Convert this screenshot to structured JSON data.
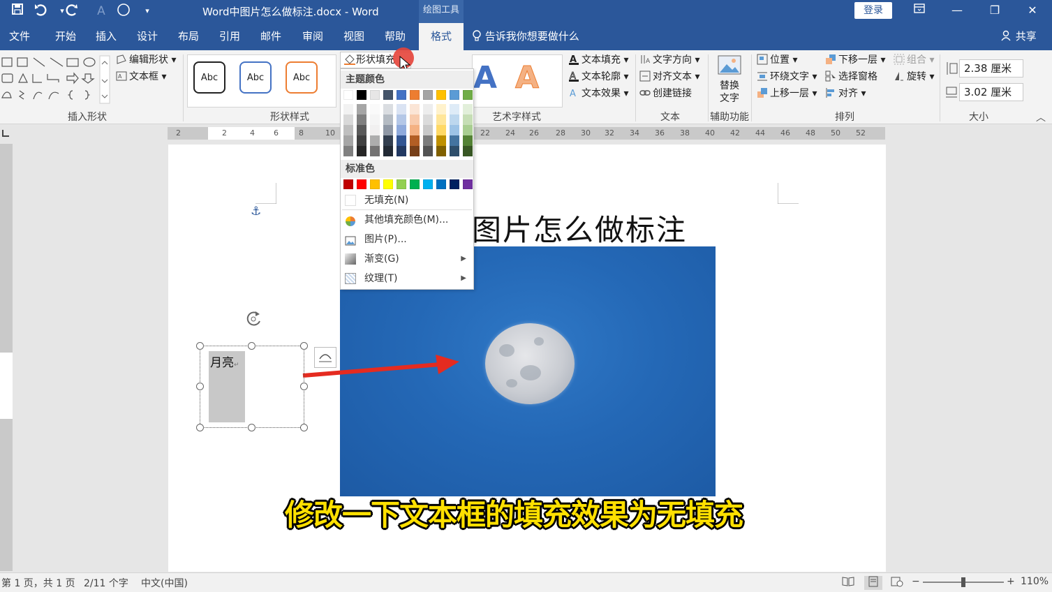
{
  "title_bar": {
    "doc_title": "Word中图片怎么做标注.docx  -  Word",
    "context_tab": "绘图工具",
    "login_label": "登录",
    "icons": [
      "save-icon",
      "undo-icon",
      "redo-icon",
      "text-effect-icon",
      "shape-oval-icon",
      "customize-qat-icon"
    ]
  },
  "tabs": [
    {
      "label": "文件"
    },
    {
      "label": "开始"
    },
    {
      "label": "插入"
    },
    {
      "label": "设计"
    },
    {
      "label": "布局"
    },
    {
      "label": "引用"
    },
    {
      "label": "邮件"
    },
    {
      "label": "审阅"
    },
    {
      "label": "视图"
    },
    {
      "label": "帮助"
    },
    {
      "label": "格式",
      "active": true
    }
  ],
  "tell_me": "告诉我你想要做什么",
  "share_label": "共享",
  "ribbon": {
    "insert_shapes": {
      "edit_shape": "编辑形状",
      "text_box": "文本框",
      "label": "插入形状"
    },
    "shape_styles": {
      "samples": [
        "Abc",
        "Abc",
        "Abc"
      ],
      "shape_fill": "形状填充",
      "label": "形状样式"
    },
    "wordart": {
      "text_fill": "文本填充",
      "text_outline": "文本轮廓",
      "text_effects": "文本效果",
      "label": "艺术字样式"
    },
    "text": {
      "text_direction": "文字方向",
      "align_text": "对齐文本",
      "create_link": "创建链接",
      "label": "文本"
    },
    "accessibility": {
      "alt_text_line1": "替换",
      "alt_text_line2": "文字",
      "label": "辅助功能"
    },
    "arrange": {
      "position": "位置",
      "wrap_text": "环绕文字",
      "bring_forward": "上移一层",
      "send_backward": "下移一层",
      "selection_pane": "选择窗格",
      "align": "对齐",
      "group": "组合",
      "rotate": "旋转",
      "label": "排列"
    },
    "size": {
      "height": "2.38 厘米",
      "width": "3.02 厘米",
      "label": "大小"
    }
  },
  "ruler_numbers": [
    "2",
    "2",
    "4",
    "6",
    "8",
    "10",
    "22",
    "24",
    "26",
    "28",
    "30",
    "32",
    "34",
    "36",
    "38",
    "40",
    "42",
    "44",
    "46",
    "48",
    "50",
    "52"
  ],
  "dropdown": {
    "theme_colors_header": "主题颜色",
    "standard_colors_header": "标准色",
    "no_fill": "无填充(N)",
    "more_colors": "其他填充颜色(M)...",
    "picture": "图片(P)...",
    "gradient": "渐变(G)",
    "texture": "纹理(T)",
    "theme_colors": [
      "#ffffff",
      "#000000",
      "#e7e6e6",
      "#44546a",
      "#4472c4",
      "#ed7d31",
      "#a5a5a5",
      "#ffc000",
      "#5b9bd5",
      "#70ad47"
    ],
    "standard_colors": [
      "#c00000",
      "#ff0000",
      "#ffc000",
      "#ffff00",
      "#92d050",
      "#00b050",
      "#00b0f0",
      "#0070c0",
      "#002060",
      "#7030a0"
    ]
  },
  "document": {
    "heading": "图片怎么做标注",
    "textbox_text": "月亮",
    "caption": "修改一下文本框的填充效果为无填充"
  },
  "status_bar": {
    "page": "第 1 页，共 1 页",
    "words": "2/11 个字",
    "language": "中文(中国)",
    "zoom": "110%"
  }
}
